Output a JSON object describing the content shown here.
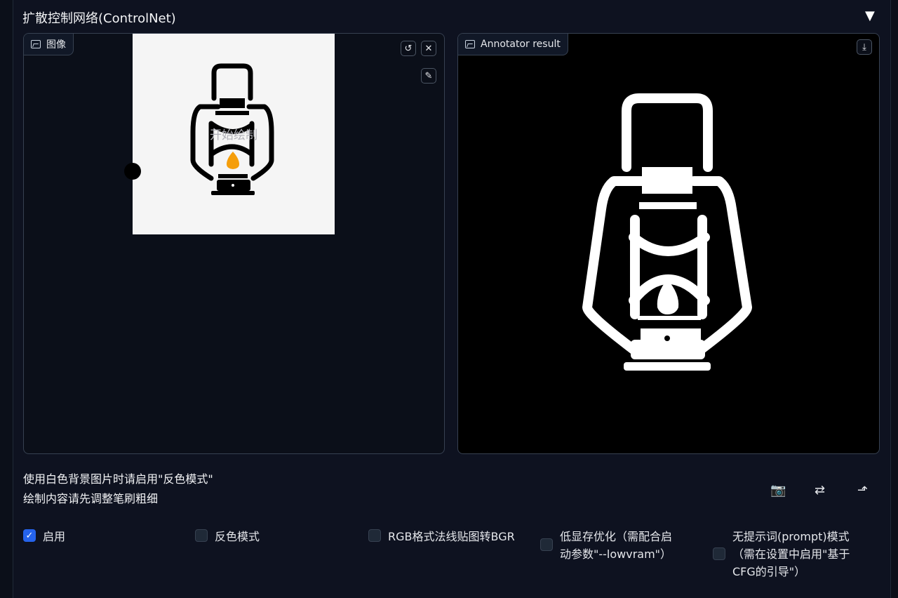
{
  "accordion": {
    "title": "扩散控制网络(ControlNet)",
    "toggle": "▼"
  },
  "image_panel": {
    "label": "图像",
    "canvas_text": "开始绘制"
  },
  "result_panel": {
    "label": "Annotator result"
  },
  "hints": {
    "line1": "使用白色背景图片时请启用\"反色模式\"",
    "line2": "绘制内容请先调整笔刷粗细"
  },
  "tools": {
    "camera": "📷",
    "swap": "⇄",
    "send": "⬏"
  },
  "checkboxes": [
    {
      "label": "启用",
      "checked": true
    },
    {
      "label": "反色模式",
      "checked": false
    },
    {
      "label": "RGB格式法线贴图转BGR",
      "checked": false
    },
    {
      "label_line1": "低显存优化（需配合启",
      "label_line2": "动参数\"--lowvram\"）",
      "checked": false
    },
    {
      "label_line1": "无提示词(prompt)模式",
      "label_line2": "（需在设置中启用\"基于",
      "label_line3": "CFG的引导\"）",
      "checked": false
    }
  ]
}
